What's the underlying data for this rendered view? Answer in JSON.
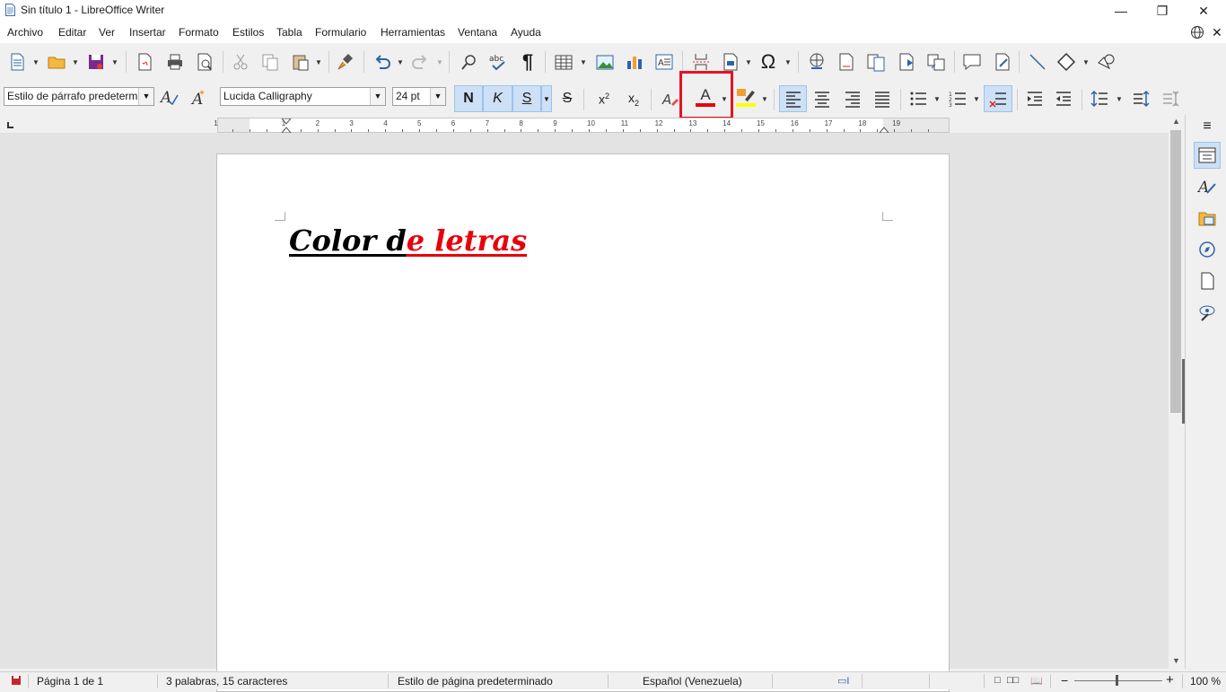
{
  "window": {
    "title": "Sin título 1 - LibreOffice Writer"
  },
  "menu": {
    "items": [
      "Archivo",
      "Editar",
      "Ver",
      "Insertar",
      "Formato",
      "Estilos",
      "Tabla",
      "Formulario",
      "Herramientas",
      "Ventana",
      "Ayuda"
    ]
  },
  "formatting": {
    "paragraph_style": "Estilo de párrafo predetermi",
    "font_name": "Lucida Calligraphy",
    "font_size": "24 pt",
    "bold_label": "N",
    "italic_label": "K",
    "underline_label": "S",
    "strike_label": "S",
    "font_color_label": "A",
    "font_color": "#e8000b",
    "highlight_color": "#ffff00"
  },
  "ruler": {
    "labels": [
      "1",
      "1",
      "2",
      "3",
      "4",
      "5",
      "6",
      "7",
      "8",
      "9",
      "10",
      "11",
      "12",
      "13",
      "14",
      "15",
      "16",
      "17",
      "18",
      "19"
    ]
  },
  "document": {
    "text_black": "Color d",
    "text_red": "e letras",
    "red_color": "#e8000b"
  },
  "status": {
    "page": "Página 1 de 1",
    "words": "3 palabras, 15 caracteres",
    "page_style": "Estilo de página predeterminado",
    "language": "Español (Venezuela)",
    "zoom": "100 %"
  },
  "colors": {
    "accent_highlight": "#e81123",
    "pressed_bg": "#cde0f5"
  }
}
